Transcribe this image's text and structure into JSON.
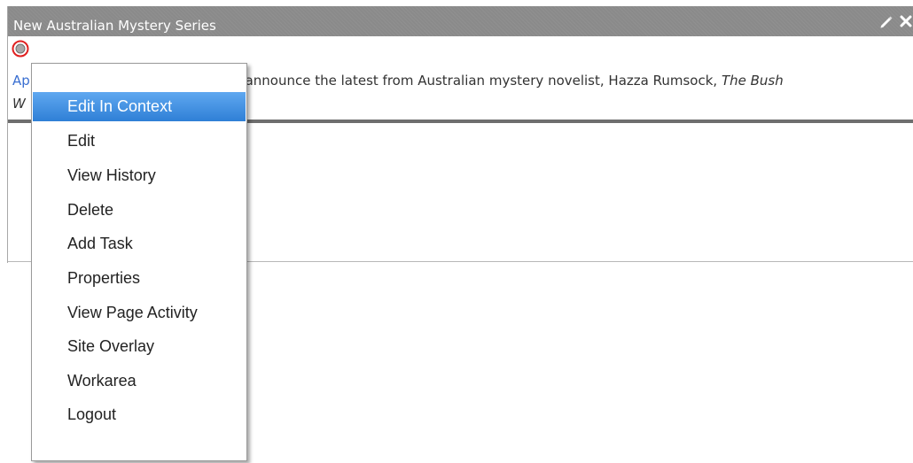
{
  "window": {
    "title": "New Australian Mystery Series",
    "icons": [
      "pencil-icon",
      "close-icon"
    ]
  },
  "content": {
    "link_fragment": "Ap",
    "text": "announce the latest from Australian mystery novelist, Hazza Rumsock,",
    "italic_title_start": "The Bush",
    "second_line_fragment": "W"
  },
  "context_menu": {
    "items": [
      {
        "label": "Edit In Context",
        "active": true
      },
      {
        "label": "Edit"
      },
      {
        "label": "View History"
      },
      {
        "label": "Delete"
      },
      {
        "label": "Add Task"
      },
      {
        "label": "Properties"
      },
      {
        "label": "View Page Activity"
      },
      {
        "label": "Site Overlay"
      },
      {
        "label": "Workarea"
      },
      {
        "label": "Logout"
      }
    ]
  },
  "colors": {
    "titlebar": "#8a8a8a",
    "menu_highlight": "#3f8fe0",
    "marker_ring": "#e02020"
  }
}
